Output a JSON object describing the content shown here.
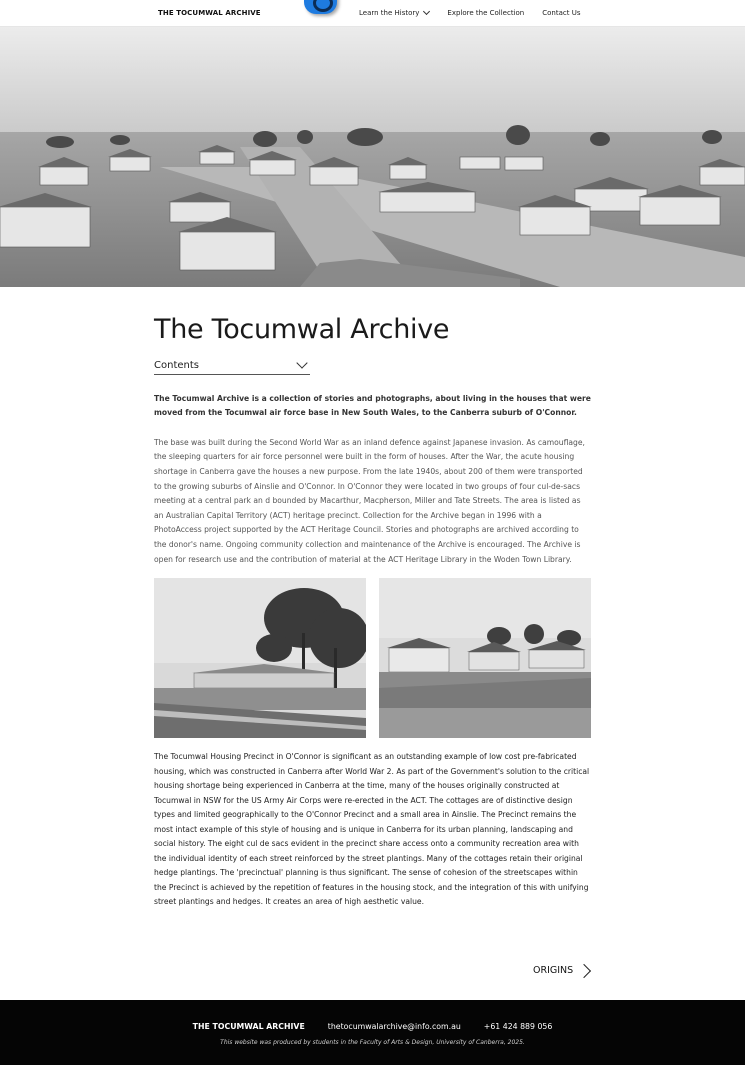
{
  "nav": {
    "brand": "THE TOCUMWAL ARCHIVE",
    "links": [
      {
        "label": "Learn the History"
      },
      {
        "label": "Explore the Collection"
      },
      {
        "label": "Contact Us"
      }
    ]
  },
  "main": {
    "title": "The Tocumwal Archive",
    "contents_label": "Contents",
    "lead": "The Tocumwal Archive is a collection of stories and photographs, about living in the houses that were moved from the Tocumwal air force base in New South Wales, to the Canberra suburb of O'Connor.",
    "paragraph1": "The base was built during the Second World War as an inland defence against Japanese invasion. As camouflage, the sleeping quarters for air force personnel were built in the form of houses. After the War, the acute housing shortage in Canberra gave the houses a new purpose. From the late 1940s, about 200 of them were transported to the growing suburbs of Ainslie and O'Connor. In O'Connor they were located in two groups of four cul-de-sacs meeting at a central park an d bounded by Macarthur, Macpherson, Miller and Tate Streets. The area is listed as an Australian Capital Territory (ACT) heritage precinct. Collection for the Archive began in 1996 with a PhotoAccess project supported by the ACT Heritage Council. Stories and photographs are archived according to the donor's name. Ongoing community collection and maintenance of the Archive is encouraged. The Archive is open for research use and the contribution of material at the ACT Heritage Library in the Woden Town Library.",
    "paragraph2": "The Tocumwal Housing Precinct in O'Connor is significant as an outstanding example of low cost pre-fabricated housing, which was constructed in Canberra after World War 2. As part of the Government's solution to the critical housing shortage being experienced in Canberra at the time, many of the houses originally constructed at Tocumwal in NSW for the US Army Air Corps were re-erected in the ACT. The cottages are of distinctive design types and limited geographically to the O'Connor Precinct and a small area in Ainslie. The Precinct remains the most intact example of this style of housing and is unique in Canberra for its urban planning, landscaping and social history. The eight cul de sacs evident in the precinct share access onto a community recreation area with the individual identity of each street reinforced by the street plantings. Many of the cottages retain their original hedge plantings. The 'precinctual' planning is thus significant. The sense of cohesion of the streetscapes within the Precinct is achieved by the repetition of features in the housing stock, and the integration of this with unifying street plantings and hedges. It creates an area of high aesthetic value.",
    "next_label": "ORIGINS"
  },
  "footer": {
    "brand": "THE TOCUMWAL ARCHIVE",
    "email": "thetocumwalarchive@info.com.au",
    "phone": "+61 424 889 056",
    "note": "This website was produced by students in the Faculty of Arts & Design, University of Canberra, 2025."
  },
  "icons": {
    "logo": "archive-logo-icon",
    "dropdown": "chevron-down-icon",
    "next": "chevron-right-icon"
  },
  "colors": {
    "logo_blue": "#1e7be0",
    "footer_bg": "#050505"
  }
}
